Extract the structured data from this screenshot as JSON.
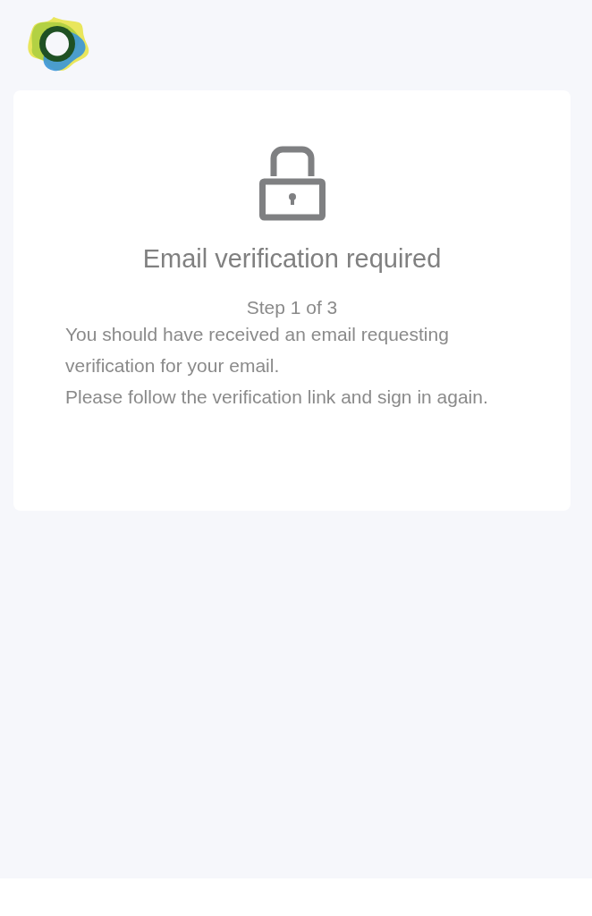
{
  "card": {
    "title": "Email verification required",
    "step": "Step 1 of 3",
    "paragraphs": [
      "You should have received an email requesting verification for your email.",
      "Please follow the verification link and sign in again."
    ]
  }
}
